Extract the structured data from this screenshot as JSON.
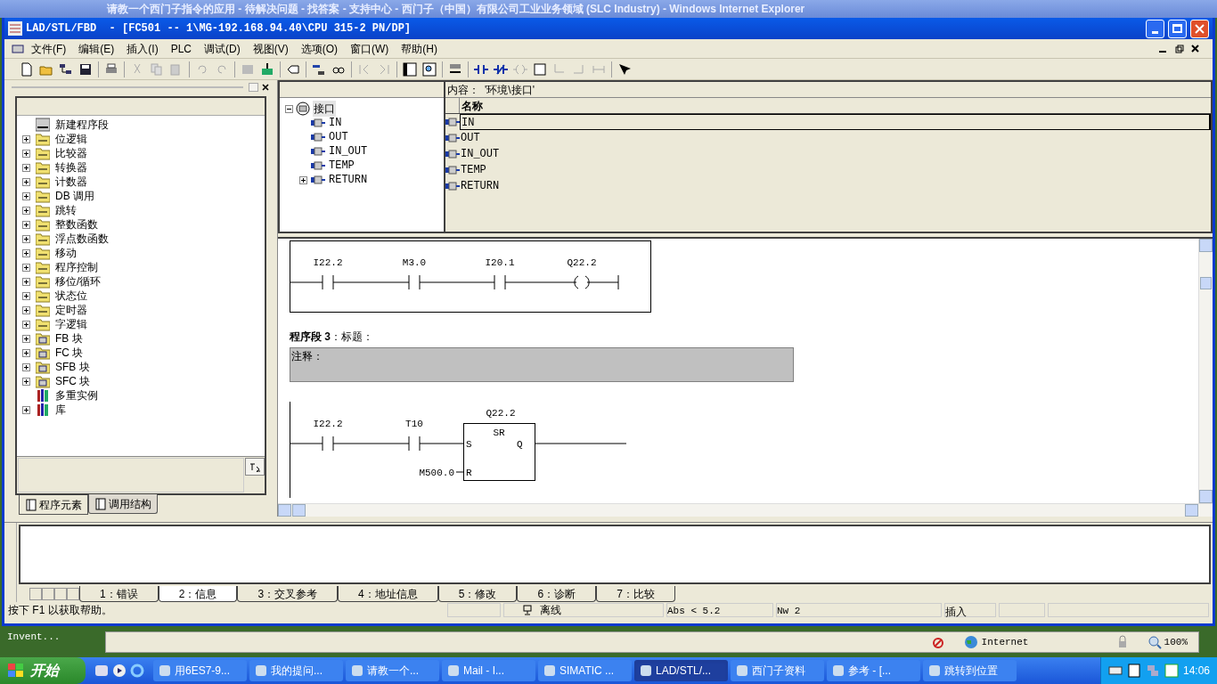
{
  "background_window": {
    "title": "请教一个西门子指令的应用 - 待解决问题 - 找答案 - 支持中心 - 西门子（中国）有限公司工业业务领域 (SLC Industry) - Windows Internet Explorer"
  },
  "window": {
    "title": "LAD/STL/FBD  - [FC501 -- 1\\MG-192.168.94.40\\CPU 315-2 PN/DP]"
  },
  "menu": [
    "文件(F)",
    "编辑(E)",
    "插入(I)",
    "PLC",
    "调试(D)",
    "视图(V)",
    "选项(O)",
    "窗口(W)",
    "帮助(H)"
  ],
  "left_panel": {
    "items": [
      {
        "label": "新建程序段",
        "kind": "network",
        "expandable": false
      },
      {
        "label": "位逻辑",
        "kind": "folder",
        "expandable": true
      },
      {
        "label": "比较器",
        "kind": "folder",
        "expandable": true
      },
      {
        "label": "转换器",
        "kind": "folder",
        "expandable": true
      },
      {
        "label": "计数器",
        "kind": "folder",
        "expandable": true
      },
      {
        "label": "DB 调用",
        "kind": "folder",
        "expandable": true
      },
      {
        "label": "跳转",
        "kind": "folder",
        "expandable": true
      },
      {
        "label": "整数函数",
        "kind": "folder",
        "expandable": true
      },
      {
        "label": "浮点数函数",
        "kind": "folder",
        "expandable": true
      },
      {
        "label": "移动",
        "kind": "folder",
        "expandable": true
      },
      {
        "label": "程序控制",
        "kind": "folder",
        "expandable": true
      },
      {
        "label": "移位/循环",
        "kind": "folder",
        "expandable": true
      },
      {
        "label": "状态位",
        "kind": "folder",
        "expandable": true
      },
      {
        "label": "定时器",
        "kind": "folder",
        "expandable": true
      },
      {
        "label": "字逻辑",
        "kind": "folder",
        "expandable": true
      },
      {
        "label": "FB 块",
        "kind": "block",
        "expandable": true
      },
      {
        "label": "FC 块",
        "kind": "block",
        "expandable": true
      },
      {
        "label": "SFB 块",
        "kind": "block",
        "expandable": true
      },
      {
        "label": "SFC 块",
        "kind": "block",
        "expandable": true
      },
      {
        "label": "多重实例",
        "kind": "books",
        "expandable": false
      },
      {
        "label": "库",
        "kind": "books",
        "expandable": true
      }
    ],
    "tabs": [
      {
        "label": "程序元素",
        "selected": true
      },
      {
        "label": "调用结构",
        "selected": false
      }
    ]
  },
  "interface": {
    "root": {
      "label": "接口",
      "selected": true
    },
    "tree": [
      {
        "label": "IN",
        "expandable": false
      },
      {
        "label": "OUT",
        "expandable": false
      },
      {
        "label": "IN_OUT",
        "expandable": false
      },
      {
        "label": "TEMP",
        "expandable": false
      },
      {
        "label": "RETURN",
        "expandable": true
      }
    ],
    "content_label": "内容：",
    "content_path": "'环境\\接口'",
    "column": "名称",
    "rows": [
      {
        "name": "IN",
        "selected": true
      },
      {
        "name": "OUT",
        "selected": false
      },
      {
        "name": "IN_OUT",
        "selected": false
      },
      {
        "name": "TEMP",
        "selected": false
      },
      {
        "name": "RETURN",
        "selected": false
      }
    ]
  },
  "network_2": {
    "contacts": [
      "I22.2",
      "M3.0",
      "I20.1"
    ],
    "coil": "Q22.2"
  },
  "network_3": {
    "title": "**程序段 3**：标题：",
    "comment": "注释：",
    "contacts": [
      "I22.2",
      "T10"
    ],
    "box": {
      "type": "SR",
      "address": "Q22.2",
      "set": "S",
      "reset": "R",
      "output": "Q",
      "reset_operand": "M500.0"
    }
  },
  "output_tabs": [
    {
      "label": "1：错误",
      "selected": false
    },
    {
      "label": "2：信息",
      "selected": true
    },
    {
      "label": "3：交叉参考",
      "selected": false
    },
    {
      "label": "4：地址信息",
      "selected": false
    },
    {
      "label": "5：修改",
      "selected": false
    },
    {
      "label": "6：诊断",
      "selected": false
    },
    {
      "label": "7：比较",
      "selected": false
    }
  ],
  "status_bar": {
    "help": "按下 F1 以获取帮助。",
    "mode": "离线",
    "position": "Abs < 5.2",
    "network": "Nw 2",
    "insert": "插入"
  },
  "desktop_label": "Invent...",
  "ie_status": {
    "zone": "Internet",
    "zoom": "100%"
  },
  "taskbar": {
    "start": "开始",
    "buttons": [
      {
        "label": "用6ES7-9...",
        "selected": false
      },
      {
        "label": "我的提问...",
        "selected": false
      },
      {
        "label": "请教一个...",
        "selected": false
      },
      {
        "label": "Mail - I...",
        "selected": false
      },
      {
        "label": "SIMATIC ...",
        "selected": false
      },
      {
        "label": "LAD/STL/...",
        "selected": true
      },
      {
        "label": "西门子资料",
        "selected": false
      },
      {
        "label": "参考 - [...",
        "selected": false
      },
      {
        "label": "跳转到位置",
        "selected": false
      }
    ],
    "clock": "14:06"
  }
}
